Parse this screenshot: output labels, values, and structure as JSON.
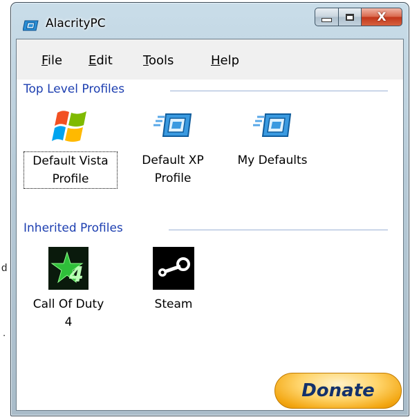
{
  "background": {
    "fragment_1": "d",
    "fragment_2": "."
  },
  "window": {
    "title": "AlacrityPC",
    "close_glyph": "X"
  },
  "menu": {
    "file": {
      "mnemonic": "F",
      "rest": "ile"
    },
    "edit": {
      "mnemonic": "E",
      "rest": "dit"
    },
    "tools": {
      "mnemonic": "T",
      "rest": "ools"
    },
    "help": {
      "mnemonic": "H",
      "rest": "elp"
    }
  },
  "top_level": {
    "header": "Top Level Profiles",
    "items": [
      {
        "line1": "Default Vista",
        "line2": "Profile",
        "icon": "windows-logo-icon"
      },
      {
        "line1": "Default XP",
        "line2": "Profile",
        "icon": "alacrity-profile-icon"
      },
      {
        "line1": "My Defaults",
        "line2": "",
        "icon": "alacrity-profile-icon"
      }
    ]
  },
  "inherited": {
    "header": "Inherited Profiles",
    "items": [
      {
        "line1": "Call Of Duty",
        "line2": "4",
        "icon": "call-of-duty-4-icon"
      },
      {
        "line1": "Steam",
        "line2": "",
        "icon": "steam-icon"
      }
    ]
  },
  "donate": {
    "label": "Donate"
  },
  "colors": {
    "header_text": "#1c3eb0",
    "donate_text": "#13316b",
    "close_button": "#c2361a"
  }
}
